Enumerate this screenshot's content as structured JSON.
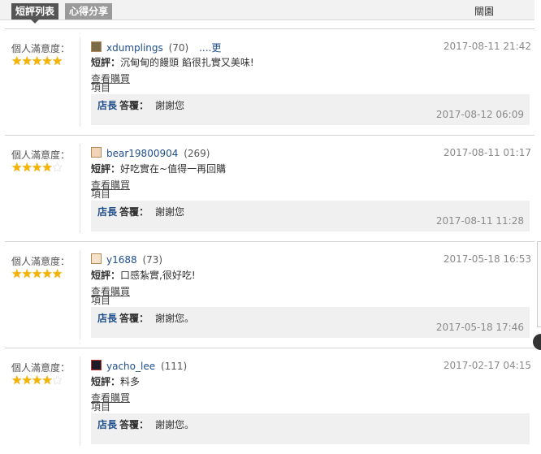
{
  "tabs": [
    "短評列表",
    "心得分享"
  ],
  "close_label": "關園",
  "colors": {
    "accent_link": "#1f4e8c",
    "star": "#f4b400",
    "tab_active": "#555555"
  },
  "satisfaction_label": "個人滿意度：",
  "buy_link": [
    "查看購買",
    "項目"
  ],
  "comment_prefix": "短評：",
  "reply_shop": "店長",
  "reply_answer": "答覆：",
  "reviews": [
    {
      "stars": 5,
      "user": "xdumplings",
      "score": "(70)",
      "more": "....更",
      "date": "2017-08-11 21:42",
      "comment": "沉甸甸的饅頭 餡很扎實又美味!",
      "reply": "謝謝您",
      "reply_date": "2017-08-12 06:09"
    },
    {
      "stars": 4,
      "user": "bear19800904",
      "score": "(269)",
      "date": "2017-08-11 01:17",
      "comment": "好吃實在~值得一再回購",
      "reply": "謝謝您",
      "reply_date": "2017-08-11 11:28"
    },
    {
      "stars": 5,
      "user": "y1688",
      "score": "(73)",
      "date": "2017-05-18 16:53",
      "comment": "口感紮實,很好吃!",
      "reply": "謝謝您。",
      "reply_date": "2017-05-18 17:46"
    },
    {
      "stars": 4,
      "user": "yacho_lee",
      "score": "(111)",
      "date": "2017-02-17 04:15",
      "comment": "料多",
      "reply": "謝謝您。",
      "reply_date": ""
    }
  ]
}
